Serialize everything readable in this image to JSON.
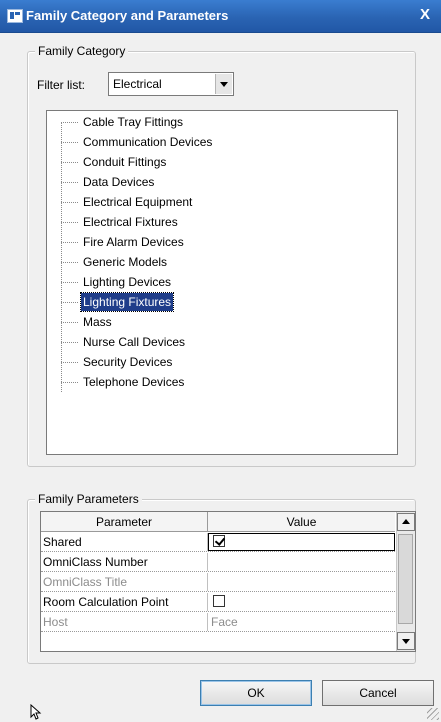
{
  "window": {
    "title": "Family Category and Parameters",
    "close_glyph": "X",
    "icon": "revit-dialog-icon"
  },
  "family_category": {
    "group_label": "Family Category",
    "filter_label": "Filter list:",
    "filter_value": "Electrical",
    "items": [
      "Cable Tray Fittings",
      "Communication Devices",
      "Conduit Fittings",
      "Data Devices",
      "Electrical Equipment",
      "Electrical Fixtures",
      "Fire Alarm Devices",
      "Generic Models",
      "Lighting Devices",
      "Lighting Fixtures",
      "Mass",
      "Nurse Call Devices",
      "Security Devices",
      "Telephone Devices"
    ],
    "selected_item": "Lighting Fixtures"
  },
  "family_parameters": {
    "group_label": "Family Parameters",
    "columns": [
      "Parameter",
      "Value"
    ],
    "rows": [
      {
        "name": "Shared",
        "value": "",
        "checkbox": true,
        "checked": true,
        "enabled": true
      },
      {
        "name": "OmniClass Number",
        "value": "",
        "checkbox": false,
        "enabled": true
      },
      {
        "name": "OmniClass Title",
        "value": "",
        "checkbox": false,
        "enabled": false
      },
      {
        "name": "Room Calculation Point",
        "value": "",
        "checkbox": true,
        "checked": false,
        "enabled": true
      },
      {
        "name": "Host",
        "value": "Face",
        "checkbox": false,
        "enabled": false
      }
    ]
  },
  "buttons": {
    "ok": "OK",
    "cancel": "Cancel"
  }
}
